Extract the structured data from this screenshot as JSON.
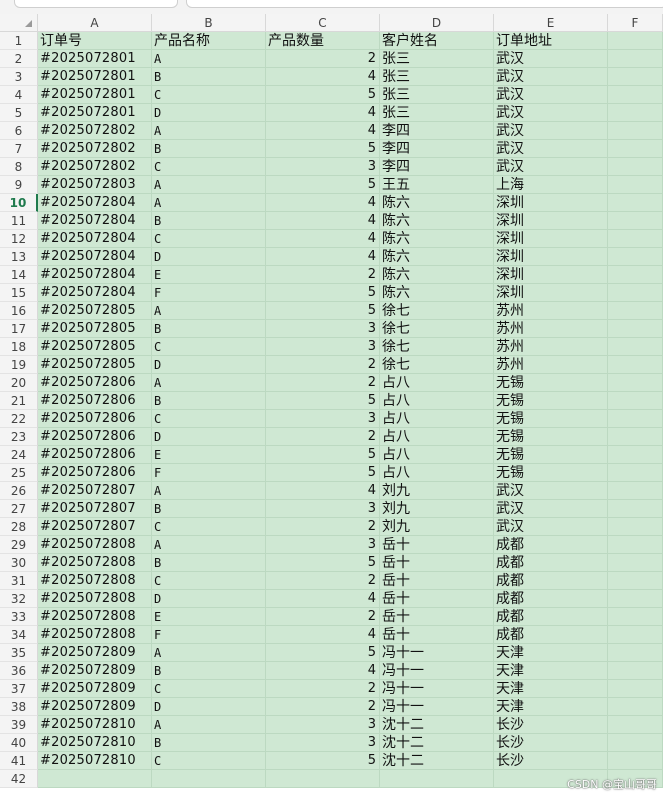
{
  "columns": [
    "A",
    "B",
    "C",
    "D",
    "E",
    "F"
  ],
  "topbar": {
    "glyph": "⌄  ∫"
  },
  "header_row": [
    "订单号",
    "产品名称",
    "产品数量",
    "客户姓名",
    "订单地址"
  ],
  "rows": [
    [
      "#2025072801",
      "A",
      "2",
      "张三",
      "武汉"
    ],
    [
      "#2025072801",
      "B",
      "4",
      "张三",
      "武汉"
    ],
    [
      "#2025072801",
      "C",
      "5",
      "张三",
      "武汉"
    ],
    [
      "#2025072801",
      "D",
      "4",
      "张三",
      "武汉"
    ],
    [
      "#2025072802",
      "A",
      "4",
      "李四",
      "武汉"
    ],
    [
      "#2025072802",
      "B",
      "5",
      "李四",
      "武汉"
    ],
    [
      "#2025072802",
      "C",
      "3",
      "李四",
      "武汉"
    ],
    [
      "#2025072803",
      "A",
      "5",
      "王五",
      "上海"
    ],
    [
      "#2025072804",
      "A",
      "4",
      "陈六",
      "深圳"
    ],
    [
      "#2025072804",
      "B",
      "4",
      "陈六",
      "深圳"
    ],
    [
      "#2025072804",
      "C",
      "4",
      "陈六",
      "深圳"
    ],
    [
      "#2025072804",
      "D",
      "4",
      "陈六",
      "深圳"
    ],
    [
      "#2025072804",
      "E",
      "2",
      "陈六",
      "深圳"
    ],
    [
      "#2025072804",
      "F",
      "5",
      "陈六",
      "深圳"
    ],
    [
      "#2025072805",
      "A",
      "5",
      "徐七",
      "苏州"
    ],
    [
      "#2025072805",
      "B",
      "3",
      "徐七",
      "苏州"
    ],
    [
      "#2025072805",
      "C",
      "3",
      "徐七",
      "苏州"
    ],
    [
      "#2025072805",
      "D",
      "2",
      "徐七",
      "苏州"
    ],
    [
      "#2025072806",
      "A",
      "2",
      "占八",
      "无锡"
    ],
    [
      "#2025072806",
      "B",
      "5",
      "占八",
      "无锡"
    ],
    [
      "#2025072806",
      "C",
      "3",
      "占八",
      "无锡"
    ],
    [
      "#2025072806",
      "D",
      "2",
      "占八",
      "无锡"
    ],
    [
      "#2025072806",
      "E",
      "5",
      "占八",
      "无锡"
    ],
    [
      "#2025072806",
      "F",
      "5",
      "占八",
      "无锡"
    ],
    [
      "#2025072807",
      "A",
      "4",
      "刘九",
      "武汉"
    ],
    [
      "#2025072807",
      "B",
      "3",
      "刘九",
      "武汉"
    ],
    [
      "#2025072807",
      "C",
      "2",
      "刘九",
      "武汉"
    ],
    [
      "#2025072808",
      "A",
      "3",
      "岳十",
      "成都"
    ],
    [
      "#2025072808",
      "B",
      "5",
      "岳十",
      "成都"
    ],
    [
      "#2025072808",
      "C",
      "2",
      "岳十",
      "成都"
    ],
    [
      "#2025072808",
      "D",
      "4",
      "岳十",
      "成都"
    ],
    [
      "#2025072808",
      "E",
      "2",
      "岳十",
      "成都"
    ],
    [
      "#2025072808",
      "F",
      "4",
      "岳十",
      "成都"
    ],
    [
      "#2025072809",
      "A",
      "5",
      "冯十一",
      "天津"
    ],
    [
      "#2025072809",
      "B",
      "4",
      "冯十一",
      "天津"
    ],
    [
      "#2025072809",
      "C",
      "2",
      "冯十一",
      "天津"
    ],
    [
      "#2025072809",
      "D",
      "2",
      "冯十一",
      "天津"
    ],
    [
      "#2025072810",
      "A",
      "3",
      "沈十二",
      "长沙"
    ],
    [
      "#2025072810",
      "B",
      "3",
      "沈十二",
      "长沙"
    ],
    [
      "#2025072810",
      "C",
      "5",
      "沈十二",
      "长沙"
    ]
  ],
  "total_rows_shown": 42,
  "active_row": 10,
  "watermark": "CSDN @宝山哥哥",
  "colors": {
    "cell_fill": "#cfe8d3",
    "active": "#1f7a4d"
  }
}
